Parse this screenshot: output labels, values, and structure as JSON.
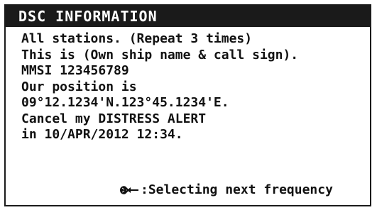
{
  "window": {
    "title": "DSC INFORMATION"
  },
  "message": {
    "lines": [
      "All stations. (Repeat 3 times)",
      "This is (Own ship name & call sign).",
      "MMSI 123456789",
      "Our position is",
      "09°12.1234'N.123°45.1234'E.",
      "Cancel my DISTRESS ALERT",
      "in 10/APR/2012 12:34."
    ]
  },
  "hint": {
    "icon": "enter-knob-icon",
    "label": ":Selecting next frequency"
  }
}
